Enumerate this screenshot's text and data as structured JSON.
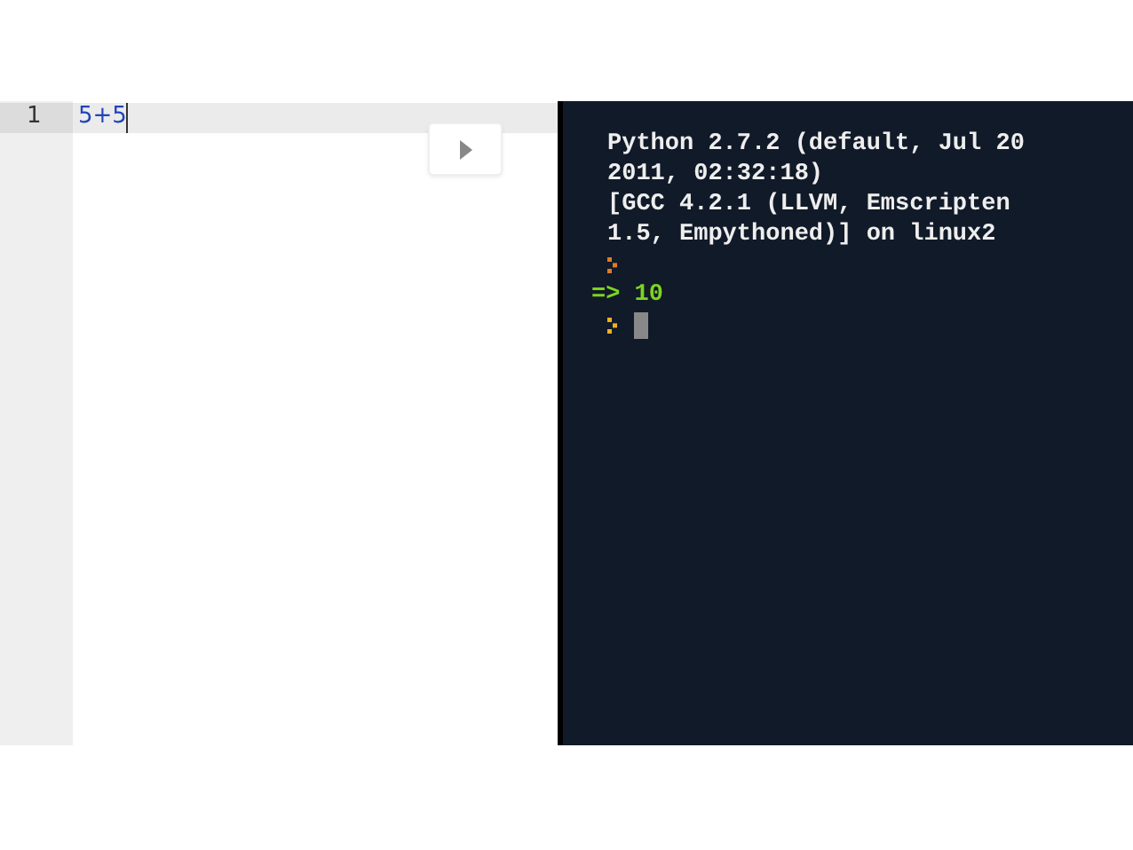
{
  "editor": {
    "lines": [
      {
        "number": "1",
        "code": "5+5",
        "active": true
      }
    ]
  },
  "console": {
    "lines": [
      {
        "kind": "output",
        "text": "Python 2.7.2 (default, Jul 20 2011, 02:32:18)"
      },
      {
        "kind": "output",
        "text": "[GCC 4.2.1 (LLVM, Emscripten 1.5, Empythoned)] on linux2"
      },
      {
        "kind": "prompt",
        "color": "#e07a2a"
      },
      {
        "kind": "result",
        "text": "=> 10"
      },
      {
        "kind": "input",
        "color": "#f0b020"
      }
    ]
  }
}
